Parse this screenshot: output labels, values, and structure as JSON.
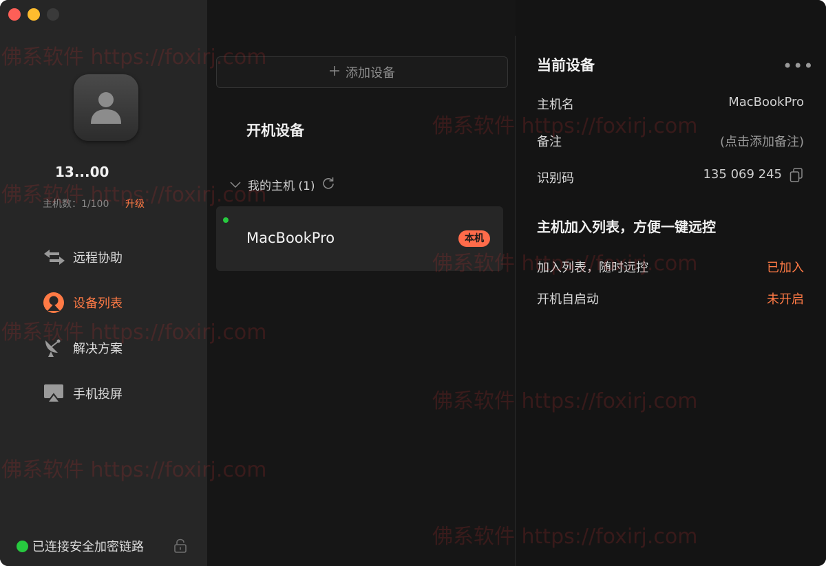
{
  "sidebar": {
    "user_name": "13...00",
    "host_count": "主机数：1/100",
    "upgrade_label": "升级",
    "nav": {
      "remote": "远程协助",
      "devices": "设备列表",
      "solutions": "解决方案",
      "mirror": "手机投屏"
    },
    "status_text": "已连接安全加密链路"
  },
  "middle": {
    "add_device": "添加设备",
    "section_title": "开机设备",
    "group_label": "我的主机 (1)",
    "device": {
      "name": "MacBookPro",
      "badge": "本机"
    }
  },
  "details": {
    "title": "当前设备",
    "more": "•••",
    "hostname_label": "主机名",
    "hostname_value": "MacBookPro",
    "note_label": "备注",
    "note_value": "(点击添加备注)",
    "id_label": "识别码",
    "id_value": "135 069 245",
    "promo_title": "主机加入列表，方便一键远控",
    "join_label": "加入列表，随时远控",
    "join_value": "已加入",
    "autostart_label": "开机自启动",
    "autostart_value": "未开启"
  },
  "watermark": "佛系软件 https://foxirj.com",
  "colors": {
    "accent": "#ff7a45",
    "online": "#27c93f",
    "badge": "#ff6b4a"
  }
}
